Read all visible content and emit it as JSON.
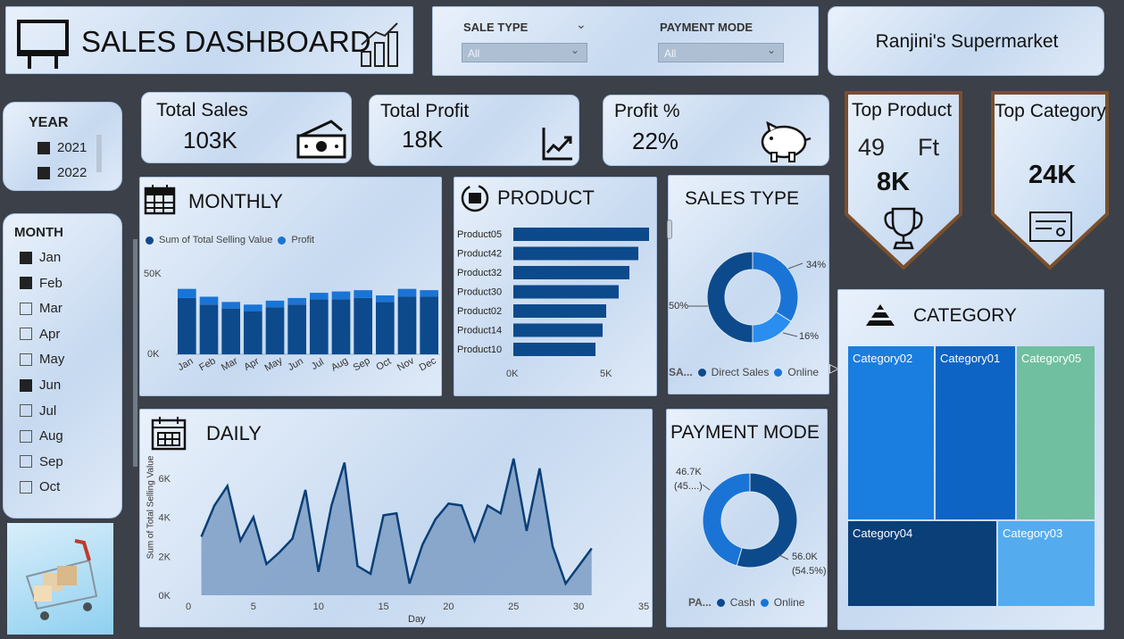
{
  "header": {
    "title": "SALES DASHBOARD",
    "store": "Ranjini's Supermarket"
  },
  "filters": {
    "sale_type_label": "SALE TYPE",
    "sale_type_value": "All",
    "payment_mode_label": "PAYMENT MODE",
    "payment_mode_value": "All"
  },
  "kpis": {
    "total_sales": {
      "label": "Total Sales",
      "value": "103K"
    },
    "total_profit": {
      "label": "Total Profit",
      "value": "18K"
    },
    "profit_pct": {
      "label": "Profit %",
      "value": "22%"
    }
  },
  "top_product": {
    "label": "Top Product",
    "line1a": "49",
    "line1b": "Ft",
    "value": "8K"
  },
  "top_category": {
    "label": "Top Category",
    "value": "24K"
  },
  "year": {
    "title": "YEAR",
    "items": [
      {
        "label": "2021",
        "checked": true
      },
      {
        "label": "2022",
        "checked": true
      }
    ]
  },
  "month": {
    "title": "MONTH",
    "items": [
      {
        "label": "Jan",
        "checked": true
      },
      {
        "label": "Feb",
        "checked": true
      },
      {
        "label": "Mar",
        "checked": false
      },
      {
        "label": "Apr",
        "checked": false
      },
      {
        "label": "May",
        "checked": false
      },
      {
        "label": "Jun",
        "checked": true
      },
      {
        "label": "Jul",
        "checked": false
      },
      {
        "label": "Aug",
        "checked": false
      },
      {
        "label": "Sep",
        "checked": false
      },
      {
        "label": "Oct",
        "checked": false
      }
    ]
  },
  "monthly": {
    "title": "MONTHLY",
    "legend": [
      "Sum of Total Selling Value",
      "Profit"
    ],
    "yticks": [
      "50K",
      "0K"
    ]
  },
  "product": {
    "title": "PRODUCT",
    "xticks": [
      "0K",
      "5K"
    ]
  },
  "sales_type": {
    "title": "SALES TYPE",
    "legend_prefix": "SA...",
    "legend": [
      "Direct Sales",
      "Online"
    ],
    "labels": [
      "34%",
      "50%",
      "16%"
    ]
  },
  "daily": {
    "title": "DAILY",
    "ylabel": "Sum of Total Selling Value",
    "xlabel": "Day",
    "yticks": [
      "6K",
      "4K",
      "2K",
      "0K"
    ],
    "xticks": [
      "0",
      "5",
      "10",
      "15",
      "20",
      "25",
      "30",
      "35"
    ]
  },
  "payment_mode": {
    "title": "PAYMENT MODE",
    "legend_prefix": "PA...",
    "legend": [
      "Cash",
      "Online"
    ],
    "label_a1": "46.7K",
    "label_a2": "(45....)",
    "label_b1": "56.0K",
    "label_b2": "(54.5%)"
  },
  "category": {
    "title": "CATEGORY",
    "tiles": [
      "Category02",
      "Category01",
      "Category05",
      "Category04",
      "Category03"
    ]
  },
  "colors": {
    "dark": "#0c4a8c",
    "mid": "#1a74d6",
    "light": "#54acef",
    "teal": "#6fbfa0",
    "navy": "#0a3f78"
  },
  "chart_data": [
    {
      "type": "bar",
      "name": "monthly",
      "categories": [
        "Jan",
        "Feb",
        "Mar",
        "Apr",
        "May",
        "Jun",
        "Jul",
        "Aug",
        "Sep",
        "Oct",
        "Nov",
        "Dec"
      ],
      "series": [
        {
          "name": "Sum of Total Selling Value",
          "values": [
            43,
            38,
            35,
            33,
            36,
            38,
            42,
            42,
            43,
            40,
            44,
            44
          ]
        },
        {
          "name": "Profit",
          "values": [
            7,
            6,
            5,
            5,
            5,
            5,
            5,
            6,
            6,
            5,
            6,
            5
          ]
        }
      ],
      "ylim": [
        0,
        60
      ]
    },
    {
      "type": "bar",
      "name": "product",
      "categories": [
        "Product05",
        "Product42",
        "Product32",
        "Product30",
        "Product02",
        "Product14",
        "Product10"
      ],
      "values": [
        7.6,
        7.0,
        6.5,
        5.9,
        5.2,
        5.0,
        4.6
      ],
      "xlim": [
        0,
        8
      ]
    },
    {
      "type": "pie",
      "name": "sales_type",
      "categories": [
        "Direct Sales",
        "Online",
        "Online2"
      ],
      "values": [
        50,
        34,
        16
      ]
    },
    {
      "type": "area",
      "name": "daily",
      "x": [
        1,
        2,
        3,
        4,
        5,
        6,
        7,
        8,
        9,
        10,
        11,
        12,
        13,
        14,
        15,
        16,
        17,
        18,
        19,
        20,
        21,
        22,
        23,
        24,
        25,
        26,
        27,
        28,
        29,
        30,
        31
      ],
      "values": [
        3.0,
        4.6,
        5.6,
        2.8,
        4.0,
        1.6,
        2.2,
        2.9,
        5.4,
        1.2,
        4.6,
        6.8,
        1.5,
        1.1,
        4.1,
        4.2,
        0.6,
        2.6,
        3.9,
        4.7,
        4.6,
        2.8,
        4.6,
        4.2,
        7.0,
        3.3,
        6.5,
        2.5,
        0.6,
        1.5,
        2.4
      ],
      "ylim": [
        0,
        7.5
      ],
      "xlim": [
        0,
        35
      ]
    },
    {
      "type": "pie",
      "name": "payment_mode",
      "categories": [
        "Cash",
        "Online"
      ],
      "values": [
        54.5,
        45.5
      ]
    }
  ]
}
